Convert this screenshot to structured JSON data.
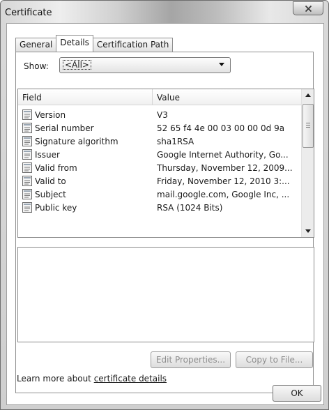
{
  "window": {
    "title": "Certificate"
  },
  "tabs": [
    {
      "label": "General"
    },
    {
      "label": "Details"
    },
    {
      "label": "Certification Path"
    }
  ],
  "show": {
    "label": "Show:",
    "selected": "<All>"
  },
  "list": {
    "columns": {
      "field": "Field",
      "value": "Value"
    },
    "rows": [
      {
        "field": "Version",
        "value": "V3"
      },
      {
        "field": "Serial number",
        "value": "52 65 f4 4e 00 03 00 00 0d 9a"
      },
      {
        "field": "Signature algorithm",
        "value": "sha1RSA"
      },
      {
        "field": "Issuer",
        "value": "Google Internet Authority, Go..."
      },
      {
        "field": "Valid from",
        "value": "Thursday, November 12, 2009..."
      },
      {
        "field": "Valid to",
        "value": "Friday, November 12, 2010 3:..."
      },
      {
        "field": "Subject",
        "value": "mail.google.com, Google Inc, ..."
      },
      {
        "field": "Public key",
        "value": "RSA (1024 Bits)"
      }
    ]
  },
  "buttons": {
    "edit_properties": "Edit Properties...",
    "copy_to_file": "Copy to File...",
    "ok": "OK"
  },
  "learn_more": {
    "prefix": "Learn more about ",
    "link": "certificate details"
  },
  "icons": {
    "close": "close-icon",
    "dropdown": "chevron-down-icon",
    "field": "document-icon"
  }
}
